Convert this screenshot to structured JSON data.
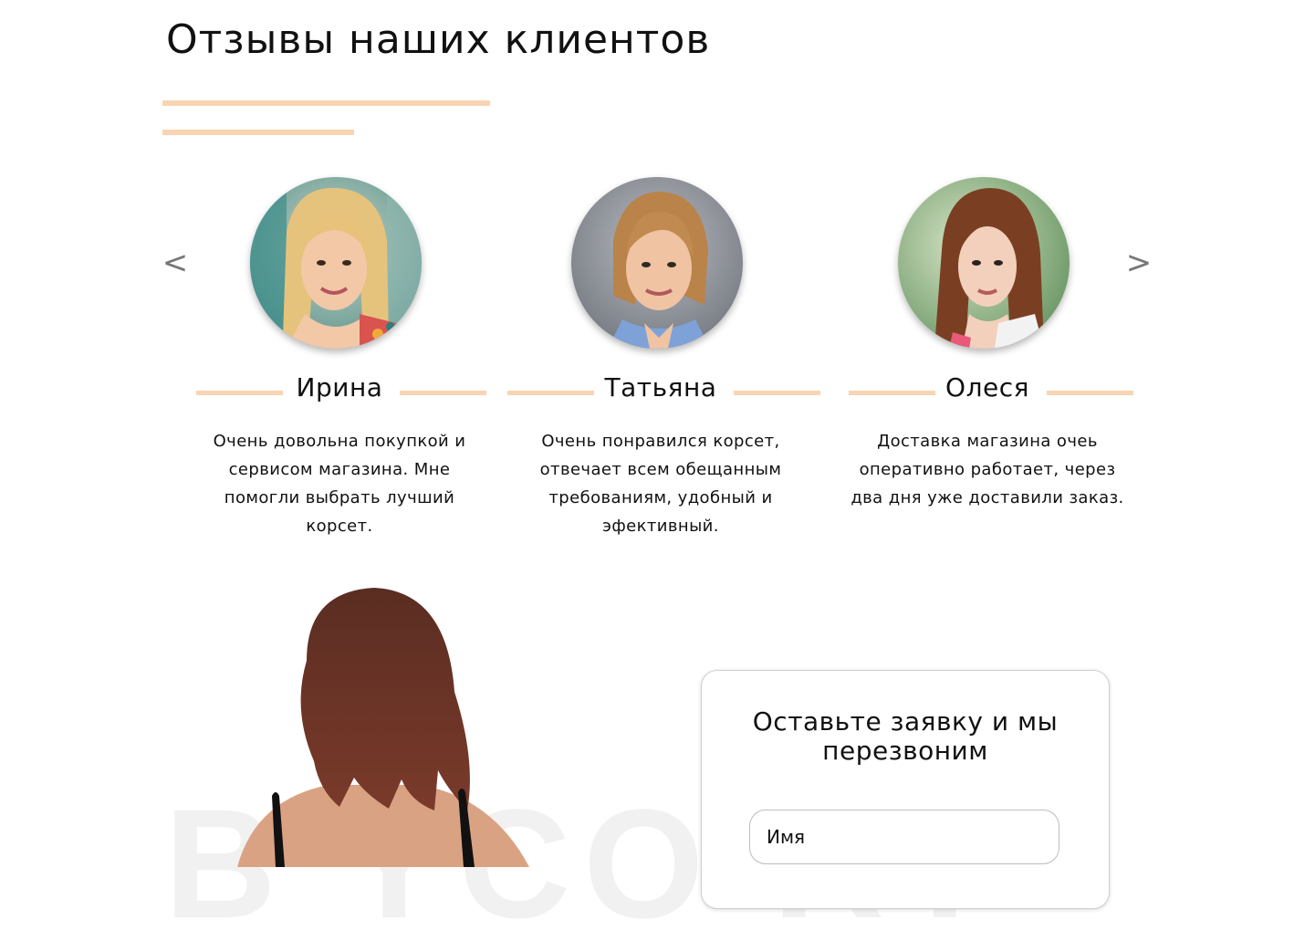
{
  "reviews_section": {
    "title": "Отзывы наших клиентов",
    "nav": {
      "prev_label": "<",
      "next_label": ">"
    },
    "accent_color": "#f8d4b2",
    "items": [
      {
        "name": "Ирина",
        "text": "Очень довольна покупкой и сервисом магазина. Мне помогли выбрать лучший корсет."
      },
      {
        "name": "Татьяна",
        "text": "Очень понравился корсет, отвечает всем обещанным требованиям, удобный и эфективный."
      },
      {
        "name": "Олеся",
        "text": "Доставка магазина очеь оперативно работает, через два дня уже доставили заказ."
      }
    ]
  },
  "callback_form": {
    "title": "Оставьте заявку и мы перезвоним",
    "name_placeholder": "Имя"
  }
}
